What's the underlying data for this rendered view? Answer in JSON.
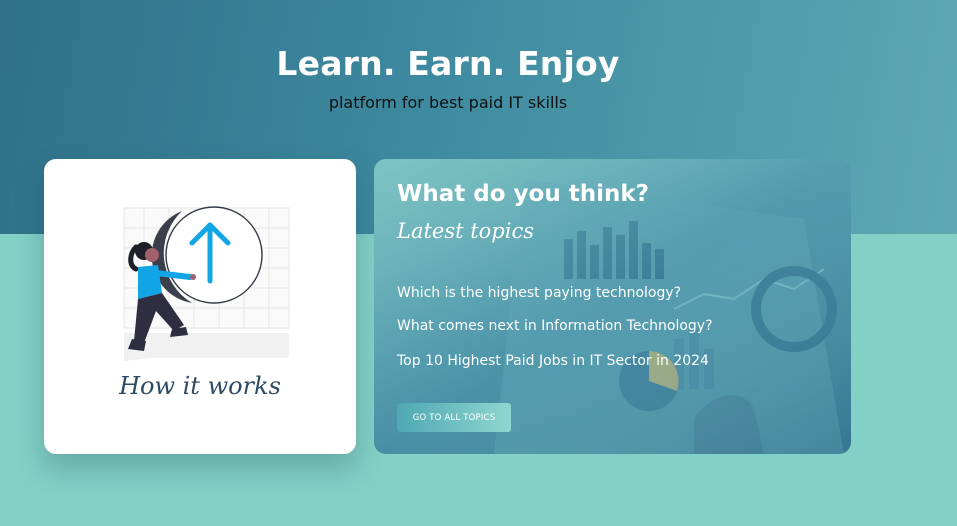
{
  "hero": {
    "title": "Learn. Earn. Enjoy",
    "subtitle": "platform for best paid IT skills"
  },
  "how_card": {
    "label": "How it works"
  },
  "topics_card": {
    "title": "What do you think?",
    "subtitle": "Latest topics",
    "topics": [
      "Which is the highest paying technology?",
      "What comes next in Information Technology?",
      "Top 10 Highest Paid Jobs in IT Sector in 2024"
    ],
    "button_label": "GO TO ALL TOPICS"
  },
  "colors": {
    "hero_band": "#3e8aa0",
    "page_background": "#82d0c6",
    "accent_blue": "#11a5e6",
    "card_white": "#ffffff"
  }
}
